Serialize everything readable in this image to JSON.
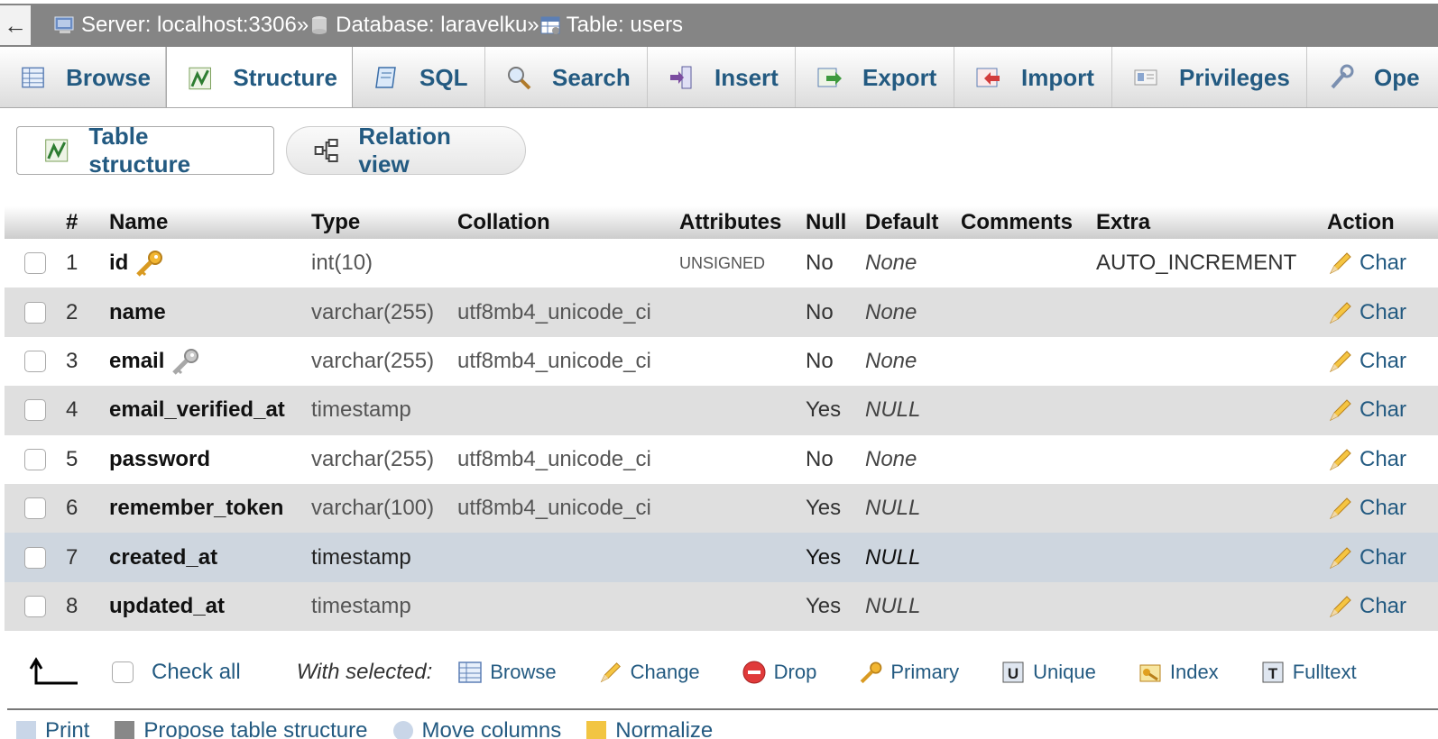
{
  "breadcrumb": {
    "back_arrow": "←",
    "server": "Server: localhost:3306",
    "database": "Database: laravelku",
    "table": "Table: users",
    "separator": "»"
  },
  "tabs": [
    {
      "label": "Browse",
      "icon": "browse-icon"
    },
    {
      "label": "Structure",
      "icon": "structure-icon",
      "active": true
    },
    {
      "label": "SQL",
      "icon": "sql-icon"
    },
    {
      "label": "Search",
      "icon": "search-icon"
    },
    {
      "label": "Insert",
      "icon": "insert-icon"
    },
    {
      "label": "Export",
      "icon": "export-icon"
    },
    {
      "label": "Import",
      "icon": "import-icon"
    },
    {
      "label": "Privileges",
      "icon": "privileges-icon"
    },
    {
      "label": "Ope",
      "icon": "wrench-icon"
    }
  ],
  "subtabs": {
    "table_structure": "Table structure",
    "relation_view": "Relation view"
  },
  "table": {
    "headers": [
      "#",
      "Name",
      "Type",
      "Collation",
      "Attributes",
      "Null",
      "Default",
      "Comments",
      "Extra",
      "Action"
    ],
    "rows": [
      {
        "num": "1",
        "name": "id",
        "type": "int(10)",
        "collation": "",
        "attributes": "UNSIGNED",
        "null": "No",
        "default": "None",
        "comments": "",
        "extra": "AUTO_INCREMENT",
        "action": "Char",
        "key": "primary"
      },
      {
        "num": "2",
        "name": "name",
        "type": "varchar(255)",
        "collation": "utf8mb4_unicode_ci",
        "attributes": "",
        "null": "No",
        "default": "None",
        "comments": "",
        "extra": "",
        "action": "Char"
      },
      {
        "num": "3",
        "name": "email",
        "type": "varchar(255)",
        "collation": "utf8mb4_unicode_ci",
        "attributes": "",
        "null": "No",
        "default": "None",
        "comments": "",
        "extra": "",
        "action": "Char",
        "key": "unique"
      },
      {
        "num": "4",
        "name": "email_verified_at",
        "type": "timestamp",
        "collation": "",
        "attributes": "",
        "null": "Yes",
        "default": "NULL",
        "comments": "",
        "extra": "",
        "action": "Char"
      },
      {
        "num": "5",
        "name": "password",
        "type": "varchar(255)",
        "collation": "utf8mb4_unicode_ci",
        "attributes": "",
        "null": "No",
        "default": "None",
        "comments": "",
        "extra": "",
        "action": "Char"
      },
      {
        "num": "6",
        "name": "remember_token",
        "type": "varchar(100)",
        "collation": "utf8mb4_unicode_ci",
        "attributes": "",
        "null": "Yes",
        "default": "NULL",
        "comments": "",
        "extra": "",
        "action": "Char"
      },
      {
        "num": "7",
        "name": "created_at",
        "type": "timestamp",
        "collation": "",
        "attributes": "",
        "null": "Yes",
        "default": "NULL",
        "comments": "",
        "extra": "",
        "action": "Char",
        "highlighted": true
      },
      {
        "num": "8",
        "name": "updated_at",
        "type": "timestamp",
        "collation": "",
        "attributes": "",
        "null": "Yes",
        "default": "NULL",
        "comments": "",
        "extra": "",
        "action": "Char"
      }
    ]
  },
  "bottom": {
    "check_all": "Check all",
    "with_selected": "With selected:",
    "actions": [
      {
        "label": "Browse",
        "icon": "browse-icon"
      },
      {
        "label": "Change",
        "icon": "pencil-icon"
      },
      {
        "label": "Drop",
        "icon": "drop-icon"
      },
      {
        "label": "Primary",
        "icon": "key-icon"
      },
      {
        "label": "Unique",
        "icon": "unique-icon"
      },
      {
        "label": "Index",
        "icon": "index-icon"
      },
      {
        "label": "Fulltext",
        "icon": "fulltext-icon"
      }
    ]
  },
  "cutoff_links": [
    "Print",
    "Propose table structure",
    "Move columns",
    "Normalize"
  ],
  "colors": {
    "link": "#235a81",
    "topbar": "#858585",
    "row_even": "#dfdfdf",
    "row_highlight": "#ced6df"
  }
}
